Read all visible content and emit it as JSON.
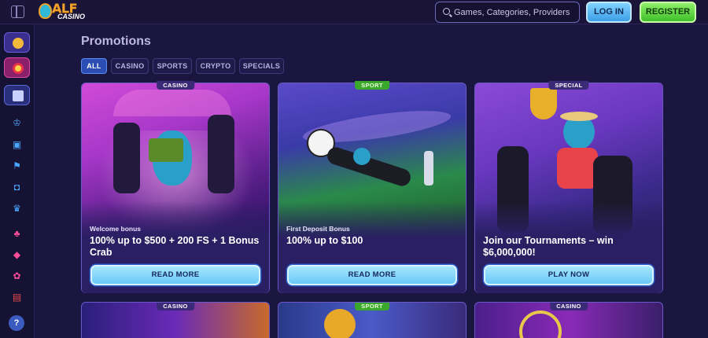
{
  "header": {
    "logo_text": "ALF",
    "logo_sub": "CASINO",
    "search_placeholder": "Games, Categories, Providers",
    "login_label": "LOG IN",
    "register_label": "REGISTER"
  },
  "sidebar": {
    "help_label": "?",
    "icons": [
      "coin-icon",
      "wheel-icon",
      "gift-icon",
      "trophy-icon",
      "briefcase-icon",
      "flag-icon",
      "bag-icon",
      "crown-icon",
      "cherries-icon",
      "dice-icon",
      "clover-icon",
      "card-icon",
      "help-icon"
    ]
  },
  "page": {
    "title": "Promotions",
    "filters": [
      "ALL",
      "CASINO",
      "SPORTS",
      "CRYPTO",
      "SPECIALS"
    ],
    "active_filter": "ALL"
  },
  "cards": [
    {
      "tag": "CASINO",
      "subtitle": "Welcome bonus",
      "title": "100% up to $500 + 200 FS + 1 Bonus Crab",
      "button": "READ MORE"
    },
    {
      "tag": "SPORT",
      "subtitle": "First Deposit Bonus",
      "title": "100% up to $100",
      "button": "READ MORE"
    },
    {
      "tag": "SPECIAL",
      "subtitle": "",
      "title": "Join our Tournaments – win $6,000,000!",
      "button": "PLAY NOW"
    }
  ],
  "row2_tags": [
    "CASINO",
    "SPORT",
    "CASINO"
  ],
  "colors": {
    "background": "#1b1640",
    "accent_blue": "#6ac8f8",
    "accent_green": "#3fbf2a",
    "card_border": "#6a58c8"
  }
}
